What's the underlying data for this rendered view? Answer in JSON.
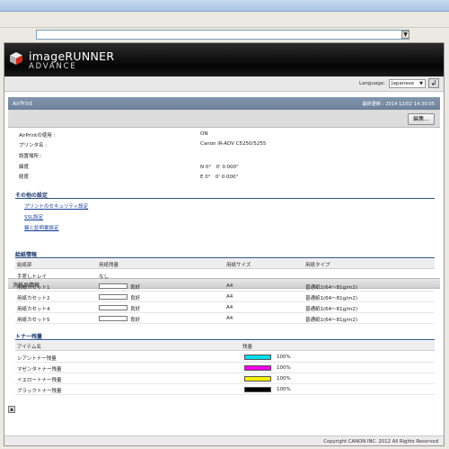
{
  "browser": {
    "address_value": "",
    "dropdown_glyph": "▼"
  },
  "brand": {
    "name": "imageRUNNER",
    "sub": "ADVANCE"
  },
  "language": {
    "label": "Language:",
    "selected": "Japanese",
    "go_glyph": "↲"
  },
  "section": {
    "title": "AirPrint",
    "last_updated": "最終更新 : 2014 12/02 14:30:05",
    "edit_button": "編集..."
  },
  "airprint_info": [
    {
      "label": "AirPrintの使用 :",
      "value": "ON"
    },
    {
      "label": "プリンタ名 :",
      "value": "Canon iR-ADV C5250/5255"
    },
    {
      "label": "設置場所 :",
      "value": ""
    },
    {
      "label": "緯度",
      "value": "N 0°　0' 0.000\""
    },
    {
      "label": "経度",
      "value": "E 0°　0' 0.000\""
    }
  ],
  "other_settings": {
    "heading": "その他の設定",
    "links": [
      "プリントのセキュリティ設定",
      "SSL設定",
      "鍵と証明書設定"
    ]
  },
  "consumables": {
    "heading": "消耗品情報",
    "paper": {
      "heading": "給紙情報",
      "columns": [
        "給紙部",
        "用紙残量",
        "用紙サイズ",
        "用紙タイプ"
      ],
      "rows": [
        {
          "source": "手差しトレイ",
          "level_text": "なし",
          "show_bar": false,
          "level": null,
          "size": "",
          "type": ""
        },
        {
          "source": "用紙カセット1",
          "level_text": "良好",
          "show_bar": true,
          "level": 1,
          "size": "A4",
          "type": "普通紙1(64〜81g/m2)"
        },
        {
          "source": "用紙カセット2",
          "level_text": "良好",
          "show_bar": true,
          "level": 1,
          "size": "A4",
          "type": "普通紙1(64〜81g/m2)"
        },
        {
          "source": "用紙カセット4",
          "level_text": "良好",
          "show_bar": true,
          "level": 1,
          "size": "A4",
          "type": "普通紙1(64〜81g/m2)"
        },
        {
          "source": "用紙カセット5",
          "level_text": "良好",
          "show_bar": true,
          "level": 1,
          "size": "A4",
          "type": "普通紙1(64〜81g/m2)"
        }
      ]
    },
    "toner": {
      "heading": "トナー残量",
      "columns": [
        "アイテム名",
        "残量"
      ],
      "rows": [
        {
          "name": "シアントナー残量",
          "percent": 100,
          "label": "100%",
          "color": "#00e0f0"
        },
        {
          "name": "マゼンタトナー残量",
          "percent": 100,
          "label": "100%",
          "color": "#f000e8"
        },
        {
          "name": "イエロートナー残量",
          "percent": 100,
          "label": "100%",
          "color": "#f8f000"
        },
        {
          "name": "ブラックトナー残量",
          "percent": 100,
          "label": "100%",
          "color": "#000000"
        }
      ]
    }
  },
  "footer": {
    "copyright": "Copyright CANON INC. 2012 All Rights Reserved"
  }
}
